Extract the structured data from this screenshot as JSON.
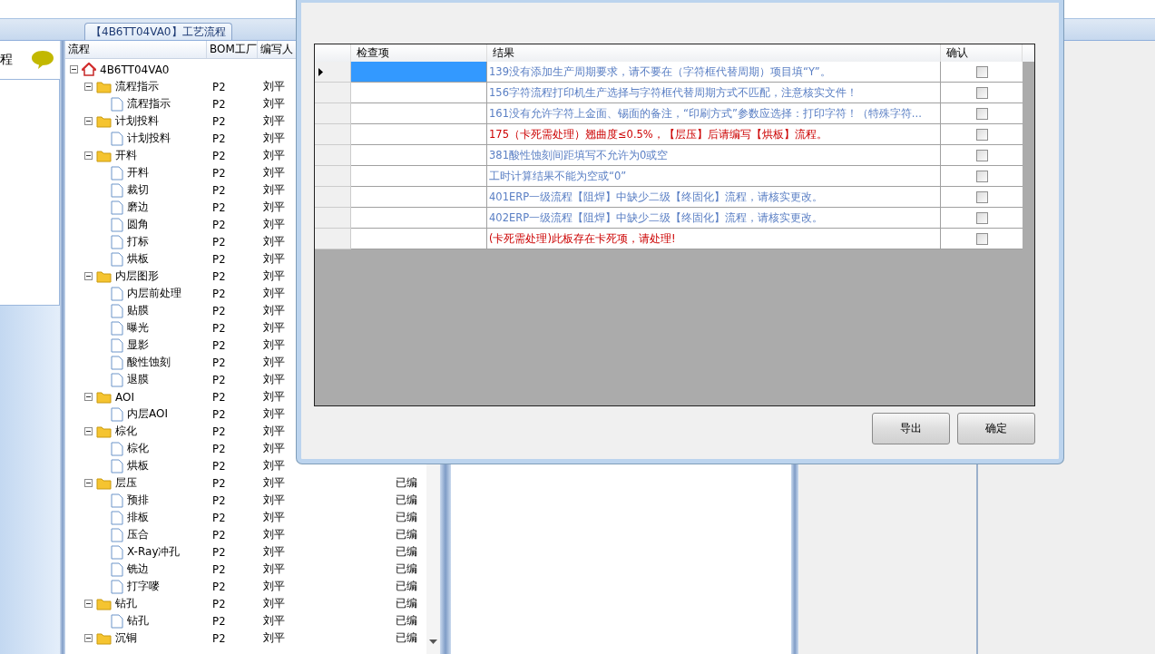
{
  "tab": {
    "label": "【4B6TT04VA0】工艺流程"
  },
  "left_panel": {
    "title": "程"
  },
  "tree": {
    "columns": [
      "流程",
      "BOM工厂",
      "编写人"
    ],
    "nodes": [
      {
        "kind": "root",
        "label": "4B6TT04VA0",
        "expanded": true,
        "children": [
          {
            "kind": "folder",
            "label": "流程指示",
            "bom": "P2",
            "author": "刘平",
            "expanded": true,
            "children": [
              {
                "kind": "file",
                "label": "流程指示",
                "bom": "P2",
                "author": "刘平"
              }
            ]
          },
          {
            "kind": "folder",
            "label": "计划投料",
            "bom": "P2",
            "author": "刘平",
            "expanded": true,
            "children": [
              {
                "kind": "file",
                "label": "计划投料",
                "bom": "P2",
                "author": "刘平"
              }
            ]
          },
          {
            "kind": "folder",
            "label": "开料",
            "bom": "P2",
            "author": "刘平",
            "expanded": true,
            "children": [
              {
                "kind": "file",
                "label": "开料",
                "bom": "P2",
                "author": "刘平"
              },
              {
                "kind": "file",
                "label": "裁切",
                "bom": "P2",
                "author": "刘平"
              },
              {
                "kind": "file",
                "label": "磨边",
                "bom": "P2",
                "author": "刘平"
              },
              {
                "kind": "file",
                "label": "圆角",
                "bom": "P2",
                "author": "刘平"
              },
              {
                "kind": "file",
                "label": "打标",
                "bom": "P2",
                "author": "刘平"
              },
              {
                "kind": "file",
                "label": "烘板",
                "bom": "P2",
                "author": "刘平"
              }
            ]
          },
          {
            "kind": "folder",
            "label": "内层图形",
            "bom": "P2",
            "author": "刘平",
            "expanded": true,
            "children": [
              {
                "kind": "file",
                "label": "内层前处理",
                "bom": "P2",
                "author": "刘平"
              },
              {
                "kind": "file",
                "label": "贴膜",
                "bom": "P2",
                "author": "刘平"
              },
              {
                "kind": "file",
                "label": "曝光",
                "bom": "P2",
                "author": "刘平"
              },
              {
                "kind": "file",
                "label": "显影",
                "bom": "P2",
                "author": "刘平"
              },
              {
                "kind": "file",
                "label": "酸性蚀刻",
                "bom": "P2",
                "author": "刘平"
              },
              {
                "kind": "file",
                "label": "退膜",
                "bom": "P2",
                "author": "刘平"
              }
            ]
          },
          {
            "kind": "folder",
            "label": "AOI",
            "bom": "P2",
            "author": "刘平",
            "expanded": true,
            "children": [
              {
                "kind": "file",
                "label": "内层AOI",
                "bom": "P2",
                "author": "刘平"
              }
            ]
          },
          {
            "kind": "folder",
            "label": "棕化",
            "bom": "P2",
            "author": "刘平",
            "expanded": true,
            "children": [
              {
                "kind": "file",
                "label": "棕化",
                "bom": "P2",
                "author": "刘平"
              },
              {
                "kind": "file",
                "label": "烘板",
                "bom": "P2",
                "author": "刘平"
              }
            ]
          },
          {
            "kind": "folder",
            "label": "层压",
            "bom": "P2",
            "author": "刘平",
            "status": "已编",
            "expanded": true,
            "children": [
              {
                "kind": "file",
                "label": "预排",
                "bom": "P2",
                "author": "刘平",
                "status": "已编"
              },
              {
                "kind": "file",
                "label": "排板",
                "bom": "P2",
                "author": "刘平",
                "status": "已编"
              },
              {
                "kind": "file",
                "label": "压合",
                "bom": "P2",
                "author": "刘平",
                "status": "已编"
              },
              {
                "kind": "file",
                "label": "X-Ray冲孔",
                "bom": "P2",
                "author": "刘平",
                "status": "已编"
              },
              {
                "kind": "file",
                "label": "铣边",
                "bom": "P2",
                "author": "刘平",
                "status": "已编"
              },
              {
                "kind": "file",
                "label": "打字嘜",
                "bom": "P2",
                "author": "刘平",
                "status": "已编"
              }
            ]
          },
          {
            "kind": "folder",
            "label": "钻孔",
            "bom": "P2",
            "author": "刘平",
            "status": "已编",
            "expanded": true,
            "children": [
              {
                "kind": "file",
                "label": "钻孔",
                "bom": "P2",
                "author": "刘平",
                "status": "已编"
              }
            ]
          },
          {
            "kind": "folder",
            "label": "沉铜",
            "bom": "P2",
            "author": "刘平",
            "status": "已编",
            "expanded": true
          }
        ]
      }
    ]
  },
  "dialog": {
    "grid": {
      "columns": [
        "检查项",
        "结果",
        "确认"
      ],
      "rows": [
        {
          "selected": true,
          "kind": "info",
          "result": "139没有添加生产周期要求，请不要在（字符框代替周期）项目填“Y”。",
          "confirmed": false
        },
        {
          "selected": false,
          "kind": "info",
          "result": "156字符流程打印机生产选择与字符框代替周期方式不匹配，注意核实文件！",
          "confirmed": false
        },
        {
          "selected": false,
          "kind": "info",
          "result": "161没有允许字符上金面、锡面的备注，“印刷方式”参数应选择：打印字符！（特殊字符...",
          "confirmed": false
        },
        {
          "selected": false,
          "kind": "error",
          "result": "175（卡死需处理）翘曲度≤0.5%，【层压】后请编写【烘板】流程。",
          "confirmed": false
        },
        {
          "selected": false,
          "kind": "info",
          "result": "381酸性蚀刻间距填写不允许为0或空",
          "confirmed": false
        },
        {
          "selected": false,
          "kind": "info",
          "result": "工时计算结果不能为空或“0”",
          "confirmed": false
        },
        {
          "selected": false,
          "kind": "info",
          "result": "401ERP一级流程【阻焊】中缺少二级【终固化】流程，请核实更改。",
          "confirmed": false
        },
        {
          "selected": false,
          "kind": "info",
          "result": "402ERP一级流程【阻焊】中缺少二级【终固化】流程，请核实更改。",
          "confirmed": false
        },
        {
          "selected": false,
          "kind": "error",
          "result": "(卡死需处理)此板存在卡死项，请处理!",
          "confirmed": false
        }
      ]
    },
    "buttons": [
      "导出",
      "确定"
    ]
  }
}
